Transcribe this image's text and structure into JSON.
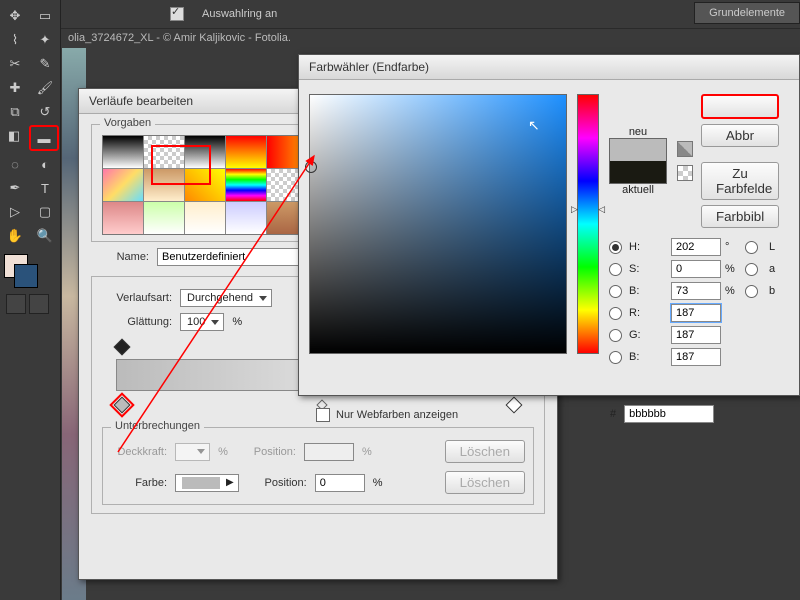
{
  "top": {
    "selring": "Auswahlring an",
    "panel": "Grundelemente"
  },
  "tab": "olia_3724672_XL - © Amir Kaljikovic - Fotolia.",
  "gradDlg": {
    "title": "Verläufe bearbeiten",
    "presets_label": "Vorgaben",
    "name_label": "Name:",
    "name_value": "Benutzerdefiniert",
    "type_label": "Verlaufsart:",
    "type_value": "Durchgehend",
    "smooth_label": "Glättung:",
    "smooth_value": "100",
    "pct": "%",
    "breaks_label": "Unterbrechungen",
    "opacity_label": "Deckkraft:",
    "position_label": "Position:",
    "position_value": "0",
    "color_label": "Farbe:",
    "delete": "Löschen"
  },
  "picker": {
    "title": "Farbwähler (Endfarbe)",
    "new": "neu",
    "current": "aktuell",
    "cancel": "Abbr",
    "lib": "Zu Farbfelde",
    "bib": "Farbbibl",
    "webonly": "Nur Webfarben anzeigen",
    "H": "H:",
    "Hv": "202",
    "Hd": "°",
    "S": "S:",
    "Sv": "0",
    "B": "B:",
    "Bv": "73",
    "R": "R:",
    "Rv": "187",
    "G": "G:",
    "Gv": "187",
    "Bl": "B:",
    "Blv": "187",
    "L": "L",
    "a": "a",
    "b": "b",
    "pct": "%",
    "hash": "#",
    "hex": "bbbbbb"
  },
  "presets": [
    "linear-gradient(#000,#fff)",
    "repeating-conic-gradient(#ccc 0 25%,#fff 0 50%) 0 0/8px 8px",
    "linear-gradient(#000,#fff)",
    "linear-gradient(red,yellow)",
    "linear-gradient(90deg,red,orange)",
    "linear-gradient(purple,orange)",
    "linear-gradient(#06c,#8cf)",
    "linear-gradient(135deg,#f7a,#fd6,#6df)",
    "linear-gradient(#c96,#fec)",
    "linear-gradient(45deg,#f80,#ff0)",
    "linear-gradient(red,yellow,lime,cyan,blue,magenta,red)",
    "repeating-conic-gradient(#ccc 0 25%,#fff 0 50%) 0 0/8px 8px",
    "linear-gradient(#0a0,#6f6)",
    "linear-gradient(#c0c,#f6f)",
    "linear-gradient(#d88,#fcc)",
    "linear-gradient(#cfa,#fff)",
    "linear-gradient(#fec,#fff)",
    "linear-gradient(#ccf,#fff)",
    "linear-gradient(#c96,#a64)",
    "linear-gradient(#eca,#fff)",
    "linear-gradient(#db9,#fed)"
  ]
}
